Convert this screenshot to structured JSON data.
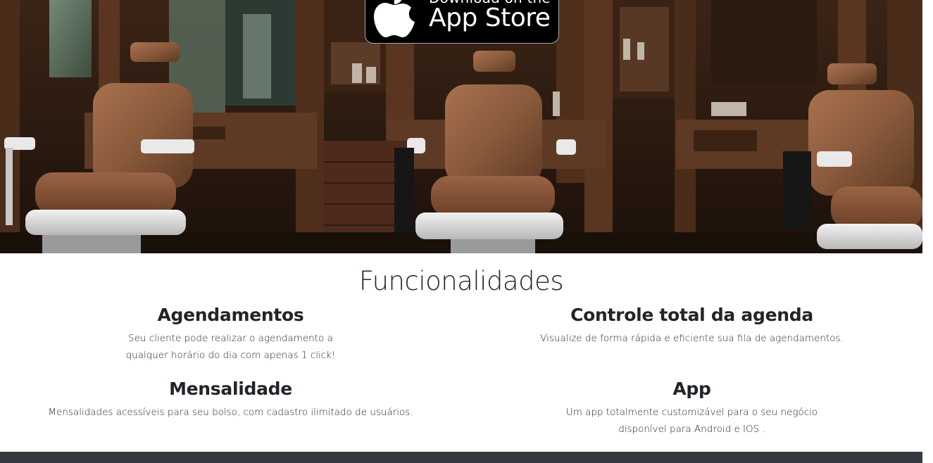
{
  "hero": {
    "badge": {
      "line_small": "Download on the",
      "line_big": "App Store",
      "icon": "apple-icon"
    }
  },
  "features": {
    "title": "Funcionalidades",
    "items": [
      {
        "heading": "Agendamentos",
        "lines": [
          "Seu cliente pode realizar o agendamento a",
          "qualquer horário do dia com apenas 1 click!"
        ]
      },
      {
        "heading": "Controle total da agenda",
        "lines": [
          "Visualize de forma rápida e eficiente sua fila de agendamentos."
        ]
      },
      {
        "heading": "Mensalidade",
        "lines": [
          "Mensalidades acessíveis para seu bolso, com cadastro ilimitado de usuários."
        ]
      },
      {
        "heading": "App",
        "lines": [
          "Um app totalmente customizável para o seu negócio",
          "disponível para Android e IOS ."
        ]
      }
    ]
  },
  "colors": {
    "footer": "#343a40",
    "text": "#212529",
    "leather": "#8a5a3c",
    "wood": "#4a2c1a"
  }
}
